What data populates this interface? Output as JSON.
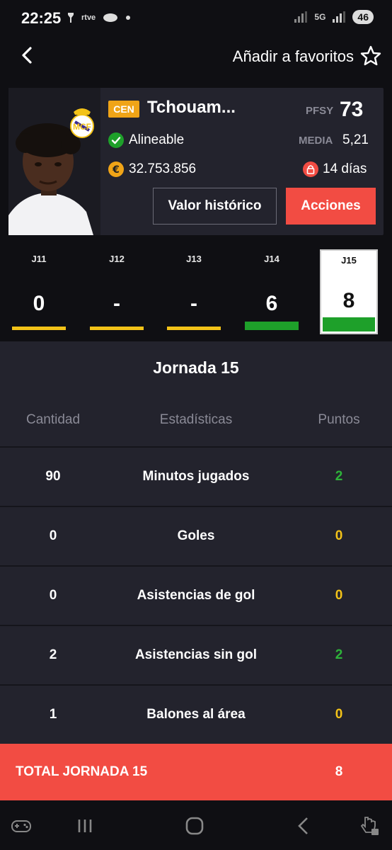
{
  "status_bar": {
    "time": "22:25",
    "left_icons": [
      "flashlight-icon",
      "rtve-play-icon",
      "movistar-icon",
      "dot-icon"
    ],
    "rtve_label": "rtve",
    "network": "5G",
    "battery": "46"
  },
  "header": {
    "favorite_label": "Añadir a favoritos",
    "back_icon": "chevron-left-icon",
    "star_icon": "star-outline-icon"
  },
  "player": {
    "position": "CEN",
    "name": "Tchouam...",
    "pfsy_label": "PFSY",
    "pfsy_value": "73",
    "status": "Alineable",
    "media_label": "MEDIA",
    "media_value": "5,21",
    "value": "32.753.856",
    "days": "14 días",
    "btn_history": "Valor histórico",
    "btn_actions": "Acciones"
  },
  "matchdays": [
    {
      "label": "J11",
      "points": "0",
      "bar_color": "#f3c318"
    },
    {
      "label": "J12",
      "points": "-",
      "bar_color": "#f3c318"
    },
    {
      "label": "J13",
      "points": "-",
      "bar_color": "#f3c318"
    },
    {
      "label": "J14",
      "points": "6",
      "bar_color": "#1ea02a"
    },
    {
      "label": "J15",
      "points": "8",
      "bar_color": "#1ea02a",
      "active": true
    }
  ],
  "stats": {
    "title": "Jornada 15",
    "headers": {
      "qty": "Cantidad",
      "stat": "Estadísticas",
      "points": "Puntos"
    },
    "rows": [
      {
        "qty": "90",
        "stat": "Minutos jugados",
        "points": "2",
        "color": "#2eb33a"
      },
      {
        "qty": "0",
        "stat": "Goles",
        "points": "0",
        "color": "#f3c318"
      },
      {
        "qty": "0",
        "stat": "Asistencias de gol",
        "points": "0",
        "color": "#f3c318"
      },
      {
        "qty": "2",
        "stat": "Asistencias sin gol",
        "points": "2",
        "color": "#2eb33a"
      },
      {
        "qty": "1",
        "stat": "Balones al área",
        "points": "0",
        "color": "#f3c318"
      }
    ],
    "total_label": "TOTAL JORNADA 15",
    "total_value": "8"
  },
  "colors": {
    "accent_red": "#f24c43",
    "badge_orange": "#f0a417",
    "green": "#1ea02a",
    "yellow": "#f3c318",
    "panel": "#23232d"
  }
}
